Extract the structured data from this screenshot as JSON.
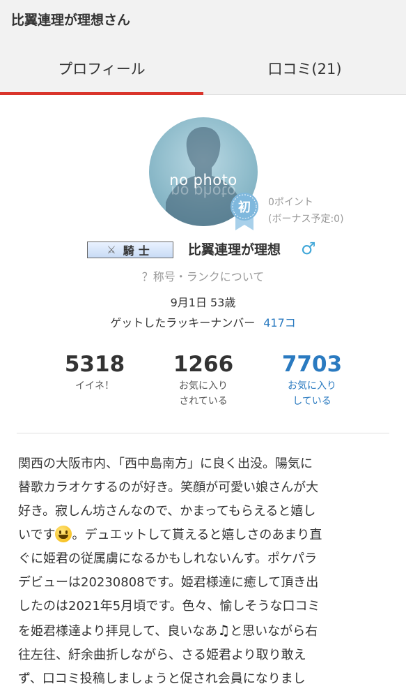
{
  "page_title": "比翼連理が理想さん",
  "tabs": [
    {
      "label": "プロフィール",
      "active": true
    },
    {
      "label": "口コミ(21)",
      "active": false
    }
  ],
  "avatar": {
    "placeholder_text": "no photo"
  },
  "badge": {
    "label": "初",
    "color": "#7fb8dd"
  },
  "points": {
    "current": "0ポイント",
    "bonus": "(ボーナス予定:0)"
  },
  "rank": {
    "title": "騎士",
    "icon": "crossed-swords-icon"
  },
  "user": {
    "name": "比翼連理が理想",
    "gender_icon": "male-icon",
    "gender_symbol": "♂"
  },
  "rank_help": "？称号・ランクについて",
  "birth_age": "9月1日 53歳",
  "lucky": {
    "label": "ゲットしたラッキーナンバー",
    "value": "417コ"
  },
  "stats": [
    {
      "value": "5318",
      "label1": "イイネ！",
      "label2": ""
    },
    {
      "value": "1266",
      "label1": "お気に入り",
      "label2": "されている"
    },
    {
      "value": "7703",
      "label1": "お気に入り",
      "label2": "している"
    }
  ],
  "bio_lines": [
    "関西の大阪市内、「西中島南方」に良く出没。陽気に",
    "替歌カラオケするのが好き。笑顔が可愛い娘さんが大",
    "好き。寂しん坊さんなので、かまってもらえると嬉し",
    "いです",
    "。デュエットして貰えると嬉しさのあまり直",
    "ぐに姫君の従属虜になるかもしれないんす。ポケパラ",
    "デビューは20230808です。姫君様達に癒して頂き出",
    "したのは2021年5月頃です。色々、愉しそうな口コミ",
    "を姫君様達より拝見して、良いなあ",
    "と思いながら右",
    "往左往、紆余曲折しながら、さる姫君より取り敢え",
    "ず、口コミ投稿しましょうと促され会員になりまし"
  ],
  "colors": {
    "accent_red": "#d9342b",
    "link_blue": "#2a7ac0",
    "male_blue": "#3fa6d8",
    "header_bg": "#f2f2f2"
  }
}
